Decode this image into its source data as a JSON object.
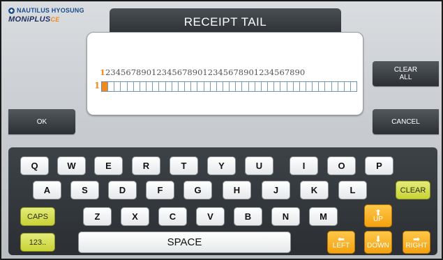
{
  "logo": {
    "brand": "NAUTILUS HYOSUNG",
    "product": "MONiPLUS",
    "product_suffix": "CE"
  },
  "title": "RECEIPT TAIL",
  "input": {
    "ruler_first": "1",
    "ruler_rest": "234567890123456789012345678901234567890",
    "row_number": "1",
    "cell_count": 40,
    "cursor_position": 1
  },
  "buttons": {
    "ok": "OK",
    "clear_all_line1": "CLEAR",
    "clear_all_line2": "ALL",
    "cancel": "CANCEL"
  },
  "keyboard": {
    "row1": [
      "Q",
      "W",
      "E",
      "R",
      "T",
      "Y",
      "U",
      "I",
      "O",
      "P"
    ],
    "row2": [
      "A",
      "S",
      "D",
      "F",
      "G",
      "H",
      "J",
      "K",
      "L"
    ],
    "row3": [
      "Z",
      "X",
      "C",
      "V",
      "B",
      "N",
      "M"
    ],
    "clear": "CLEAR",
    "caps": "CAPS",
    "numeric": "123..",
    "space": "SPACE",
    "up": "UP",
    "left": "LEFT",
    "down": "DOWN",
    "right": "RIGHT"
  },
  "colors": {
    "accent_orange": "#f08a1d",
    "key_yellow": "#c8d334",
    "key_orange": "#f3a10e",
    "title_bar": "#2e3236"
  }
}
